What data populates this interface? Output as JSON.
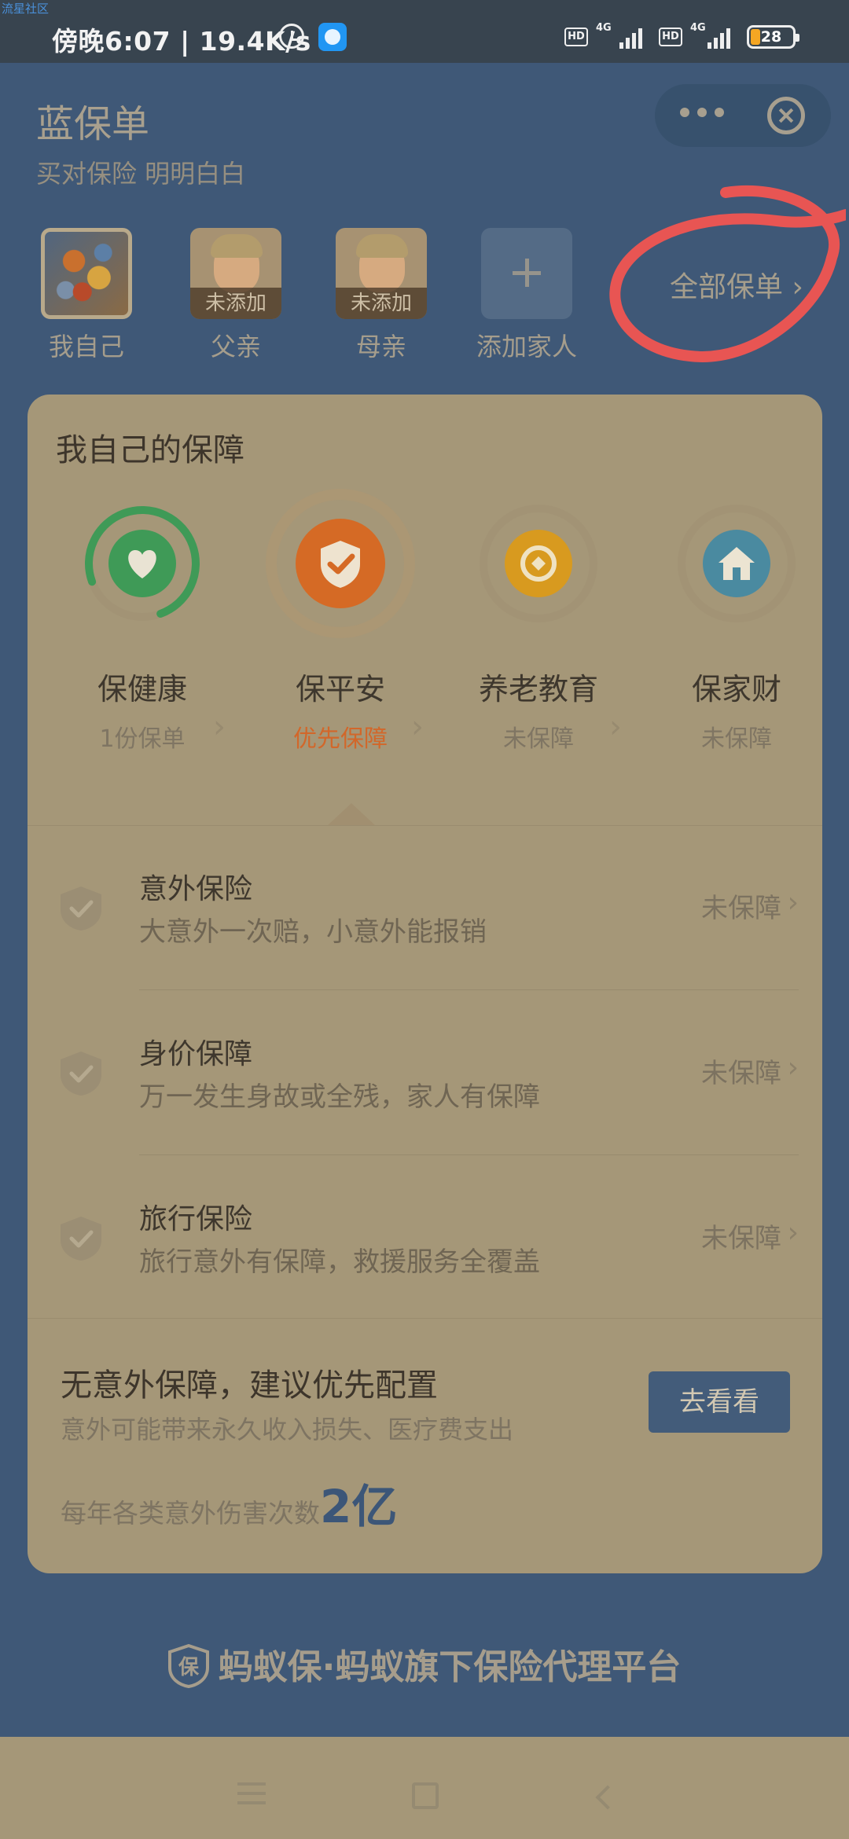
{
  "status_bar": {
    "watermark": "流星社区",
    "time_speed": "傍晚6:07 | 19.4K/s",
    "net1_hd": "HD",
    "net1_type": "4G",
    "net2_hd": "HD",
    "net2_type": "4G",
    "battery": "28"
  },
  "header": {
    "title": "蓝保单",
    "subtitle": "买对保险 明明白白"
  },
  "family": {
    "members": [
      {
        "label": "我自己",
        "tag": ""
      },
      {
        "label": "父亲",
        "tag": "未添加"
      },
      {
        "label": "母亲",
        "tag": "未添加"
      },
      {
        "label": "添加家人",
        "tag": ""
      }
    ],
    "all_policies": "全部保单 ›"
  },
  "card": {
    "title": "我自己的保障",
    "categories": [
      {
        "name": "保健康",
        "status": "1份保单",
        "icon": "heart-icon",
        "color": "#3f9a57",
        "progress": 0.75
      },
      {
        "name": "保平安",
        "status": "优先保障",
        "icon": "shield-check-icon",
        "color": "#d56a25"
      },
      {
        "name": "养老教育",
        "status": "未保障",
        "icon": "coin-icon",
        "color": "#d89a1f"
      },
      {
        "name": "保家财",
        "status": "未保障",
        "icon": "house-icon",
        "color": "#4a8aa0"
      }
    ],
    "insurances": [
      {
        "name": "意外保险",
        "desc": "大意外一次赔，小意外能报销",
        "status": "未保障"
      },
      {
        "name": "身价保障",
        "desc": "万一发生身故或全残，家人有保障",
        "status": "未保障"
      },
      {
        "name": "旅行保险",
        "desc": "旅行意外有保障，救援服务全覆盖",
        "status": "未保障"
      }
    ],
    "recommendation": {
      "title": "无意外保障，建议优先配置",
      "desc": "意外可能带来永久收入损失、医疗费支出",
      "stat_text": "每年各类意外伤害次数",
      "stat_value": "2亿",
      "button": "去看看"
    }
  },
  "footer": {
    "shield_char": "保",
    "brand": "蚂蚁保·蚂蚁旗下保险代理平台"
  },
  "colors": {
    "page_bg": "#3f5877",
    "card_bg": "#a59778",
    "accent_blue": "#435c7a",
    "highlight_orange": "#d2672a",
    "annotation_red": "#e85553"
  }
}
